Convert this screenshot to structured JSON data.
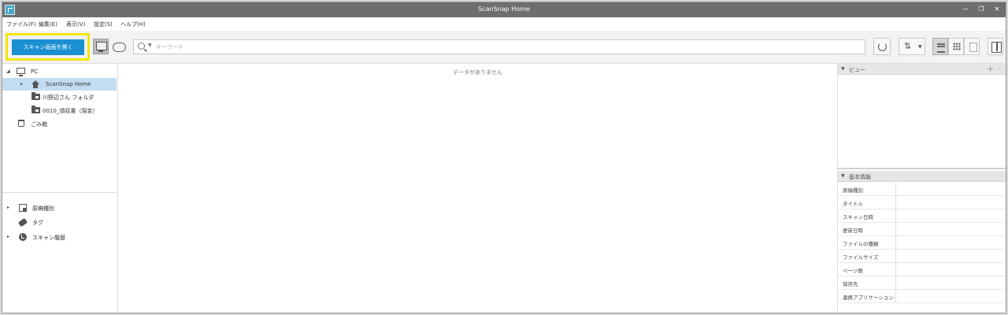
{
  "window": {
    "title": "ScanSnap Home",
    "minimize": "—",
    "restore": "❐",
    "close": "✕"
  },
  "menu": [
    "ファイル(F)",
    "編集(E)",
    "表示(V)",
    "設定(S)",
    "ヘルプ(H)"
  ],
  "toolbar": {
    "scan_button_label": "スキャン画面を開く",
    "search_placeholder": "キーワード",
    "search_value": "",
    "highlight_color": "#f2e600",
    "accent_color": "#1a8fd1"
  },
  "tree": {
    "pc_label": "PC",
    "home_label": "ScanSnap Home",
    "folders": [
      "川野辺さん フォルダ",
      "0010_領収書（現金）"
    ],
    "trash_label": "ごみ箱",
    "doc_types_label": "原稿種別",
    "tags_label": "タグ",
    "history_label": "スキャン履歴"
  },
  "main": {
    "empty_message": "データがありません"
  },
  "right_panel": {
    "view_section_title": "ビュー",
    "basic_info_title": "基本情報",
    "fields": [
      {
        "label": "原稿種別",
        "value": ""
      },
      {
        "label": "タイトル",
        "value": ""
      },
      {
        "label": "スキャン日時",
        "value": ""
      },
      {
        "label": "更新日時",
        "value": ""
      },
      {
        "label": "ファイルの種類",
        "value": ""
      },
      {
        "label": "ファイルサイズ",
        "value": ""
      },
      {
        "label": "ページ数",
        "value": ""
      },
      {
        "label": "保存先",
        "value": ""
      },
      {
        "label": "連携アプリケーション",
        "value": ""
      }
    ]
  }
}
